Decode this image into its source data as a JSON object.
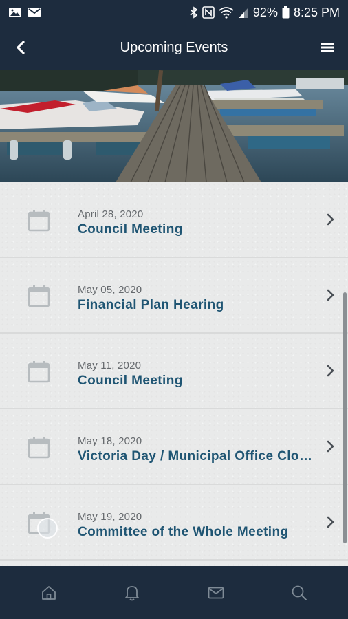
{
  "status_bar": {
    "battery": "92%",
    "time": "8:25 PM"
  },
  "header": {
    "title": "Upcoming Events"
  },
  "events": [
    {
      "date": "April 28, 2020",
      "title": "Council Meeting"
    },
    {
      "date": "May 05, 2020",
      "title": "Financial Plan Hearing"
    },
    {
      "date": "May 11, 2020",
      "title": "Council Meeting"
    },
    {
      "date": "May 18, 2020",
      "title": "Victoria Day / Municipal Office Closed"
    },
    {
      "date": "May 19, 2020",
      "title": "Committee of the Whole Meeting"
    }
  ],
  "colors": {
    "bar_bg": "#1d2c3e",
    "title_text": "#1f5573",
    "date_text": "#666a6e"
  },
  "icons": {
    "back": "chevron-left-icon",
    "menu": "hamburger-menu-icon",
    "event": "calendar-icon",
    "row_arrow": "chevron-right-icon",
    "nav": [
      "home-icon",
      "bell-icon",
      "mail-icon",
      "search-icon"
    ]
  }
}
